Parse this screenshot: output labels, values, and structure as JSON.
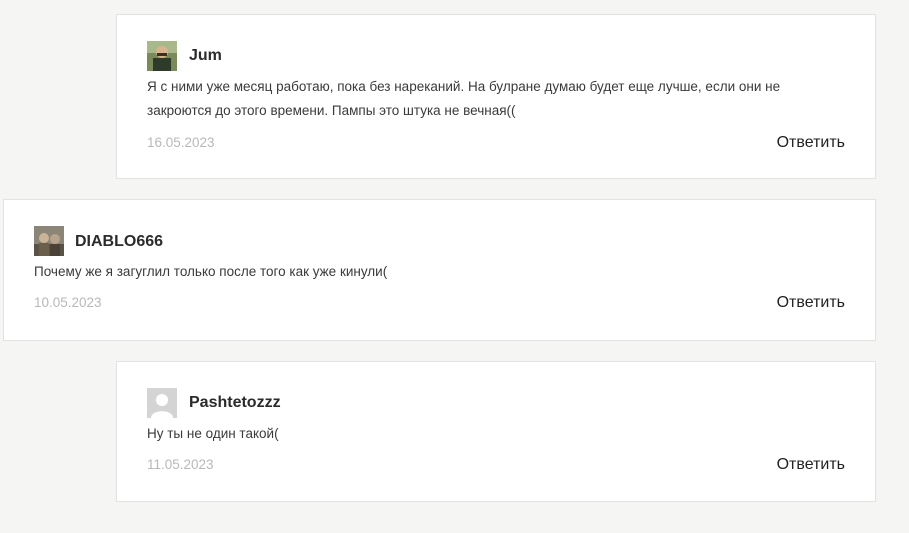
{
  "comments": [
    {
      "author": "Jum",
      "text": "Я с ними уже месяц работаю, пока без нареканий. На булране думаю будет еще лучше, если они не закроются до этого времени. Пампы это штука не вечная((",
      "date": "16.05.2023",
      "reply_label": "Ответить"
    },
    {
      "author": "DIABLO666",
      "text": "Почему же я загуглил только после того как уже кинули(",
      "date": "10.05.2023",
      "reply_label": "Ответить"
    },
    {
      "author": "Pashtetozzz",
      "text": "Ну ты не один такой(",
      "date": "11.05.2023",
      "reply_label": "Ответить"
    }
  ]
}
